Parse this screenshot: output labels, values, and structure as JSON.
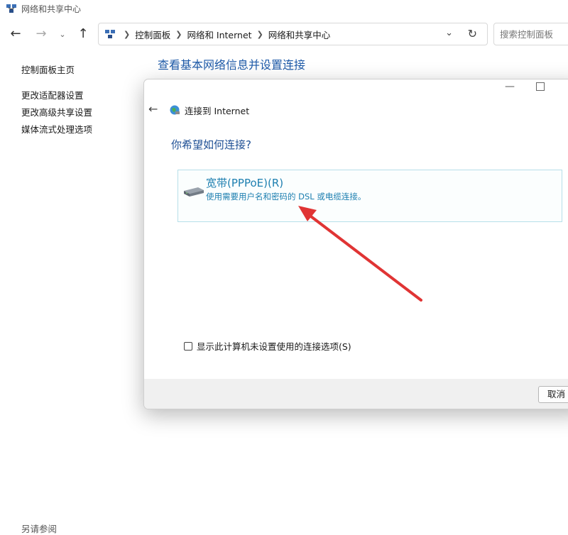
{
  "window": {
    "title": "网络和共享中心"
  },
  "address_bar": {
    "breadcrumbs": [
      "控制面板",
      "网络和 Internet",
      "网络和共享中心"
    ],
    "search_placeholder": "搜索控制面板"
  },
  "sidebar": {
    "home": "控制面板主页",
    "links": [
      "更改适配器设置",
      "更改高级共享设置",
      "媒体流式处理选项"
    ],
    "see_also": "另请参阅"
  },
  "main": {
    "heading": "查看基本网络信息并设置连接"
  },
  "dialog": {
    "title": "连接到 Internet",
    "question": "你希望如何连接?",
    "option": {
      "title": "宽带(PPPoE)(R)",
      "description": "使用需要用户名和密码的 DSL 或电缆连接。"
    },
    "checkbox_label": "显示此计算机未设置使用的连接选项(S)",
    "checkbox_checked": false,
    "cancel_label": "取消"
  },
  "colors": {
    "heading_blue": "#1e5aa8",
    "option_blue": "#1d7fb0",
    "annotation_red": "#e03434"
  }
}
